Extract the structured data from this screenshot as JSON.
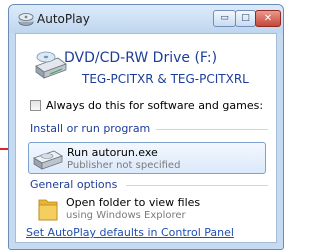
{
  "window": {
    "title": "AutoPlay",
    "buttons": {
      "minimize": "▭",
      "maximize": "□",
      "close": "✕"
    }
  },
  "drive": {
    "name": "DVD/CD-RW Drive (F:)",
    "label": "TEG-PCITXR  & TEG-PCITXRL"
  },
  "always_checkbox": {
    "label": "Always do this for software and games:",
    "checked": false
  },
  "install_group": {
    "header": "Install or run program",
    "option": {
      "title": "Run autorun.exe",
      "subtitle": "Publisher not specified",
      "icon": "cd-drive-icon"
    }
  },
  "general_group": {
    "header": "General options",
    "option": {
      "title": "Open folder to view files",
      "subtitle": "using Windows Explorer",
      "icon": "folder-icon"
    }
  },
  "control_panel_link": "Set AutoPlay defaults in Control Panel",
  "colors": {
    "accent": "#1d3d9a",
    "link": "#1f4fb0",
    "pointer": "#e8202a"
  }
}
